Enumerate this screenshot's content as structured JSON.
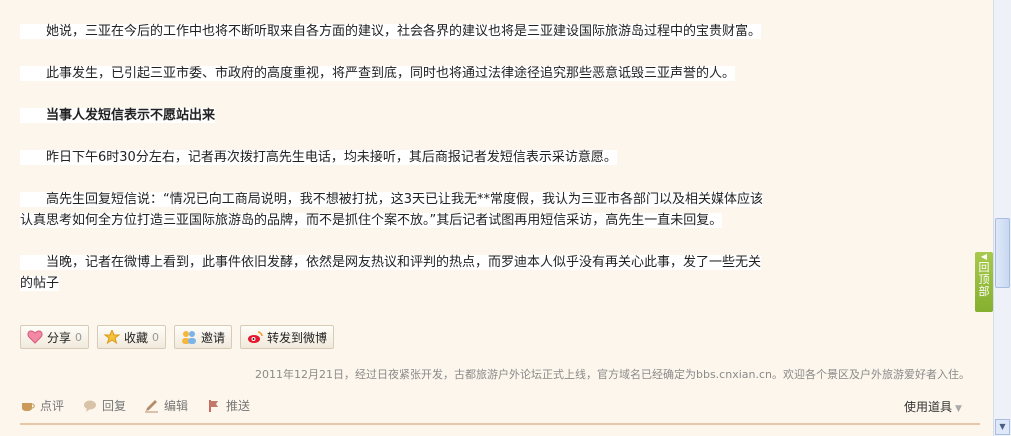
{
  "article": {
    "p1": "她说，三亚在今后的工作中也将不断听取来自各方面的建议，社会各界的建议也将是三亚建设国际旅游岛过程中的宝贵财富。",
    "p2": "此事发生，已引起三亚市委、市政府的高度重视，将严查到底，同时也将通过法律途径追究那些恶意诋毁三亚声誉的人。",
    "subheading": "当事人发短信表示不愿站出来",
    "p3": "昨日下午6时30分左右，记者再次拨打高先生电话，均未接听，其后商报记者发短信表示采访意愿。",
    "p4_line1": "高先生回复短信说：“情况已向工商局说明，我不想被打扰，这3天已让我无**常度假，我认为三亚市各部门以及相关媒体应该",
    "p4_line2": "认真思考如何全方位打造三亚国际旅游岛的品牌，而不是抓住个案不放。”其后记者试图再用短信采访，高先生一直未回复。",
    "p5_line1": "当晚，记者在微博上看到，此事件依旧发酵，依然是网友热议和评判的热点，而罗迪本人似乎没有再关心此事，发了一些无关",
    "p5_line2": "的帖子"
  },
  "actions": {
    "share_label": "分享",
    "share_count": "0",
    "fav_label": "收藏",
    "fav_count": "0",
    "invite_label": "邀请",
    "weibo_label": "转发到微博"
  },
  "signature": "2011年12月21日，经过日夜紧张开发，古都旅游户外论坛正式上线，官方域名已经确定为bbs.cnxian.cn。欢迎各个景区及户外旅游爱好者入住。",
  "footer": {
    "comment": "点评",
    "reply": "回复",
    "edit": "编辑",
    "promote": "推送",
    "tools": "使用道具"
  },
  "backtop": [
    "回",
    "顶",
    "部"
  ],
  "colors": {
    "page_bg": "#fdf6ec",
    "backtop": "#8fb536",
    "divider": "#e6c7a8"
  }
}
